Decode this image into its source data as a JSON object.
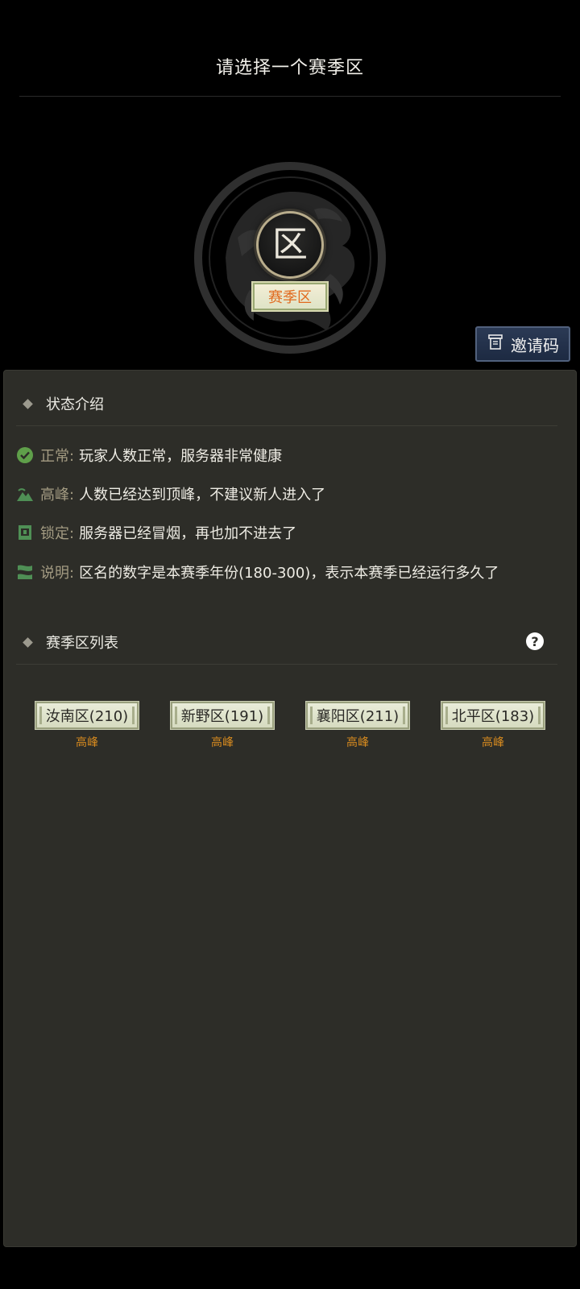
{
  "page": {
    "title": "请选择一个赛季区"
  },
  "emblem": {
    "zone_char": "区",
    "badge_label": "赛季区"
  },
  "invite": {
    "label": "邀请码",
    "icon": "scroll-icon"
  },
  "status_section": {
    "title": "状态介绍",
    "items": [
      {
        "key": "正常:",
        "desc": "玩家人数正常，服务器非常健康",
        "icon": "check-circle-icon",
        "color": "#5f9f4a"
      },
      {
        "key": "高峰:",
        "desc": "人数已经达到顶峰，不建议新人进入了",
        "icon": "mountain-icon",
        "color": "#4f8f55"
      },
      {
        "key": "锁定:",
        "desc": "服务器已经冒烟，再也加不进去了",
        "icon": "lock-icon",
        "color": "#4f8f55"
      },
      {
        "key": "说明:",
        "desc": "区名的数字是本赛季年份(180-300)，表示本赛季已经运行多久了",
        "icon": "info-flag-icon",
        "color": "#4f8f55"
      }
    ]
  },
  "zone_section": {
    "title": "赛季区列表",
    "help_icon": "help-icon",
    "zones": [
      {
        "name": "汝南区(210)",
        "status": "高峰"
      },
      {
        "name": "新野区(191)",
        "status": "高峰"
      },
      {
        "name": "襄阳区(211)",
        "status": "高峰"
      },
      {
        "name": "北平区(183)",
        "status": "高峰"
      }
    ]
  },
  "colors": {
    "panel_bg": "#2d2d28",
    "status_key": "#a39b82",
    "zone_status": "#d68a1f",
    "badge_text": "#e16a1e",
    "invite_bg": "#2b3a55"
  }
}
